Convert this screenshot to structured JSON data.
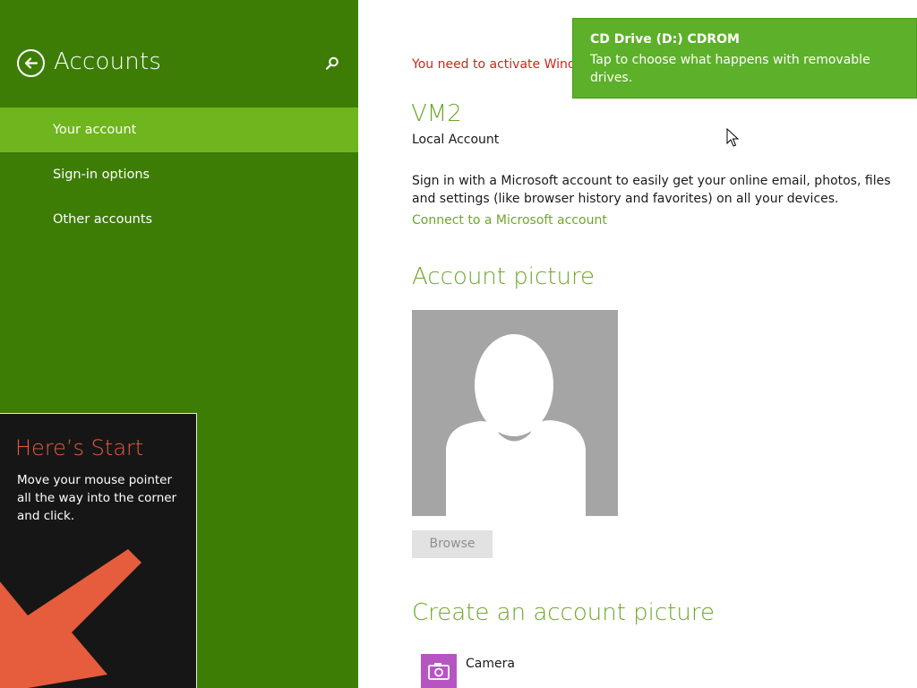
{
  "sidebar": {
    "title": "Accounts",
    "items": [
      {
        "label": "Your account",
        "selected": true
      },
      {
        "label": "Sign-in options",
        "selected": false
      },
      {
        "label": "Other accounts",
        "selected": false
      }
    ]
  },
  "start_tip": {
    "title": "Here’s Start",
    "body": "Move your mouse pointer all the way into the corner and click."
  },
  "main": {
    "activation_warning": "You need to activate Windows before you can personalize your PC.",
    "account_name": "VM2",
    "account_type": "Local Account",
    "signin_description": "Sign in with a Microsoft account to easily get your online email, photos, files and settings (like browser history and favorites) on all your devices.",
    "connect_link": "Connect to a Microsoft account",
    "account_picture_heading": "Account picture",
    "browse_label": "Browse",
    "create_picture_heading": "Create an account picture",
    "apps": [
      {
        "label": "Camera",
        "icon": "camera-icon"
      }
    ]
  },
  "toast": {
    "title": "CD Drive (D:) CDROM",
    "body": "Tap to choose what happens with removable drives."
  },
  "colors": {
    "sidebar_bg": "#3d7d06",
    "selected_item_bg": "#6fb51d",
    "accent_green": "#6ea72a",
    "warning_red": "#c8281a",
    "toast_bg": "#5db02a",
    "tip_title": "#e55d3c"
  }
}
